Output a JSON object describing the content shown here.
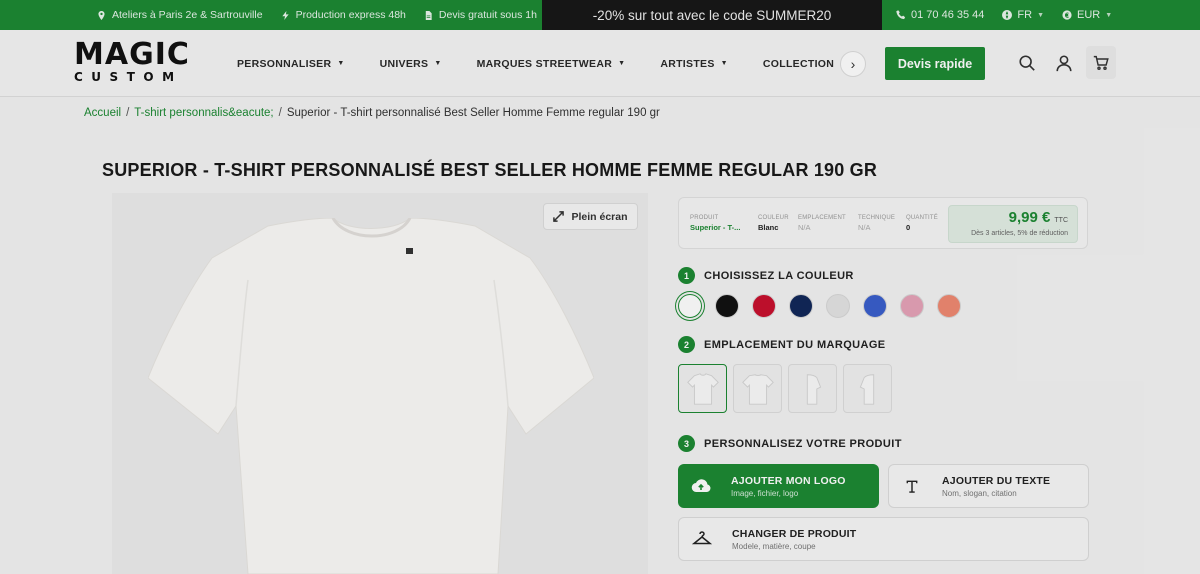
{
  "topbar": {
    "location": "Ateliers à Paris 2e & Sartrouville",
    "express": "Production express 48h",
    "quote_info": "Devis gratuit sous 1h",
    "promo": "-20% sur tout avec le code SUMMER20",
    "phone": "01 70 46 35 44",
    "language": "FR",
    "currency": "EUR"
  },
  "header": {
    "logo_top": "MAGIC",
    "logo_bottom": "CUSTOM",
    "nav": [
      "PERSONNALISER",
      "UNIVERS",
      "MARQUES STREETWEAR",
      "ARTISTES",
      "COLLECTION"
    ],
    "quote_button": "Devis rapide"
  },
  "breadcrumb": {
    "home": "Accueil",
    "category": "T-shirt personnalis&eacute;",
    "current": "Superior - T-shirt personnalisé Best Seller Homme Femme regular 190 gr"
  },
  "product": {
    "title": "SUPERIOR - T-SHIRT PERSONNALISÉ BEST SELLER HOMME FEMME REGULAR 190 GR",
    "fullscreen_label": "Plein écran"
  },
  "summary": {
    "product_label": "PRODUIT",
    "product_value": "Superior - T-...",
    "color_label": "COULEUR",
    "color_value": "Blanc",
    "placement_label": "EMPLACEMENT",
    "placement_value": "N/A",
    "technique_label": "TECHNIQUE",
    "technique_value": "N/A",
    "quantity_label": "QUANTITÉ",
    "quantity_value": "0",
    "price": "9,99 €",
    "price_suffix": "TTC",
    "price_note": "Dès 3 articles, 5% de réduction"
  },
  "steps": {
    "step1_num": "1",
    "step1_label": "CHOISISSEZ LA COULEUR",
    "step2_num": "2",
    "step2_label": "EMPLACEMENT DU MARQUAGE",
    "step3_num": "3",
    "step3_label": "PERSONNALISEZ VOTRE PRODUIT"
  },
  "colors": {
    "accent": "#1d8a34",
    "swatches": [
      "#ffffff",
      "#111111",
      "#c8102e",
      "#12285a",
      "#e4e4e4",
      "#3a5fcd",
      "#e6a3b8",
      "#f08a72"
    ]
  },
  "actions": {
    "logo_title": "AJOUTER MON LOGO",
    "logo_sub": "Image, fichier, logo",
    "text_title": "AJOUTER DU TEXTE",
    "text_sub": "Nom, slogan, citation",
    "change_title": "CHANGER DE PRODUIT",
    "change_sub": "Modele, matière, coupe"
  }
}
